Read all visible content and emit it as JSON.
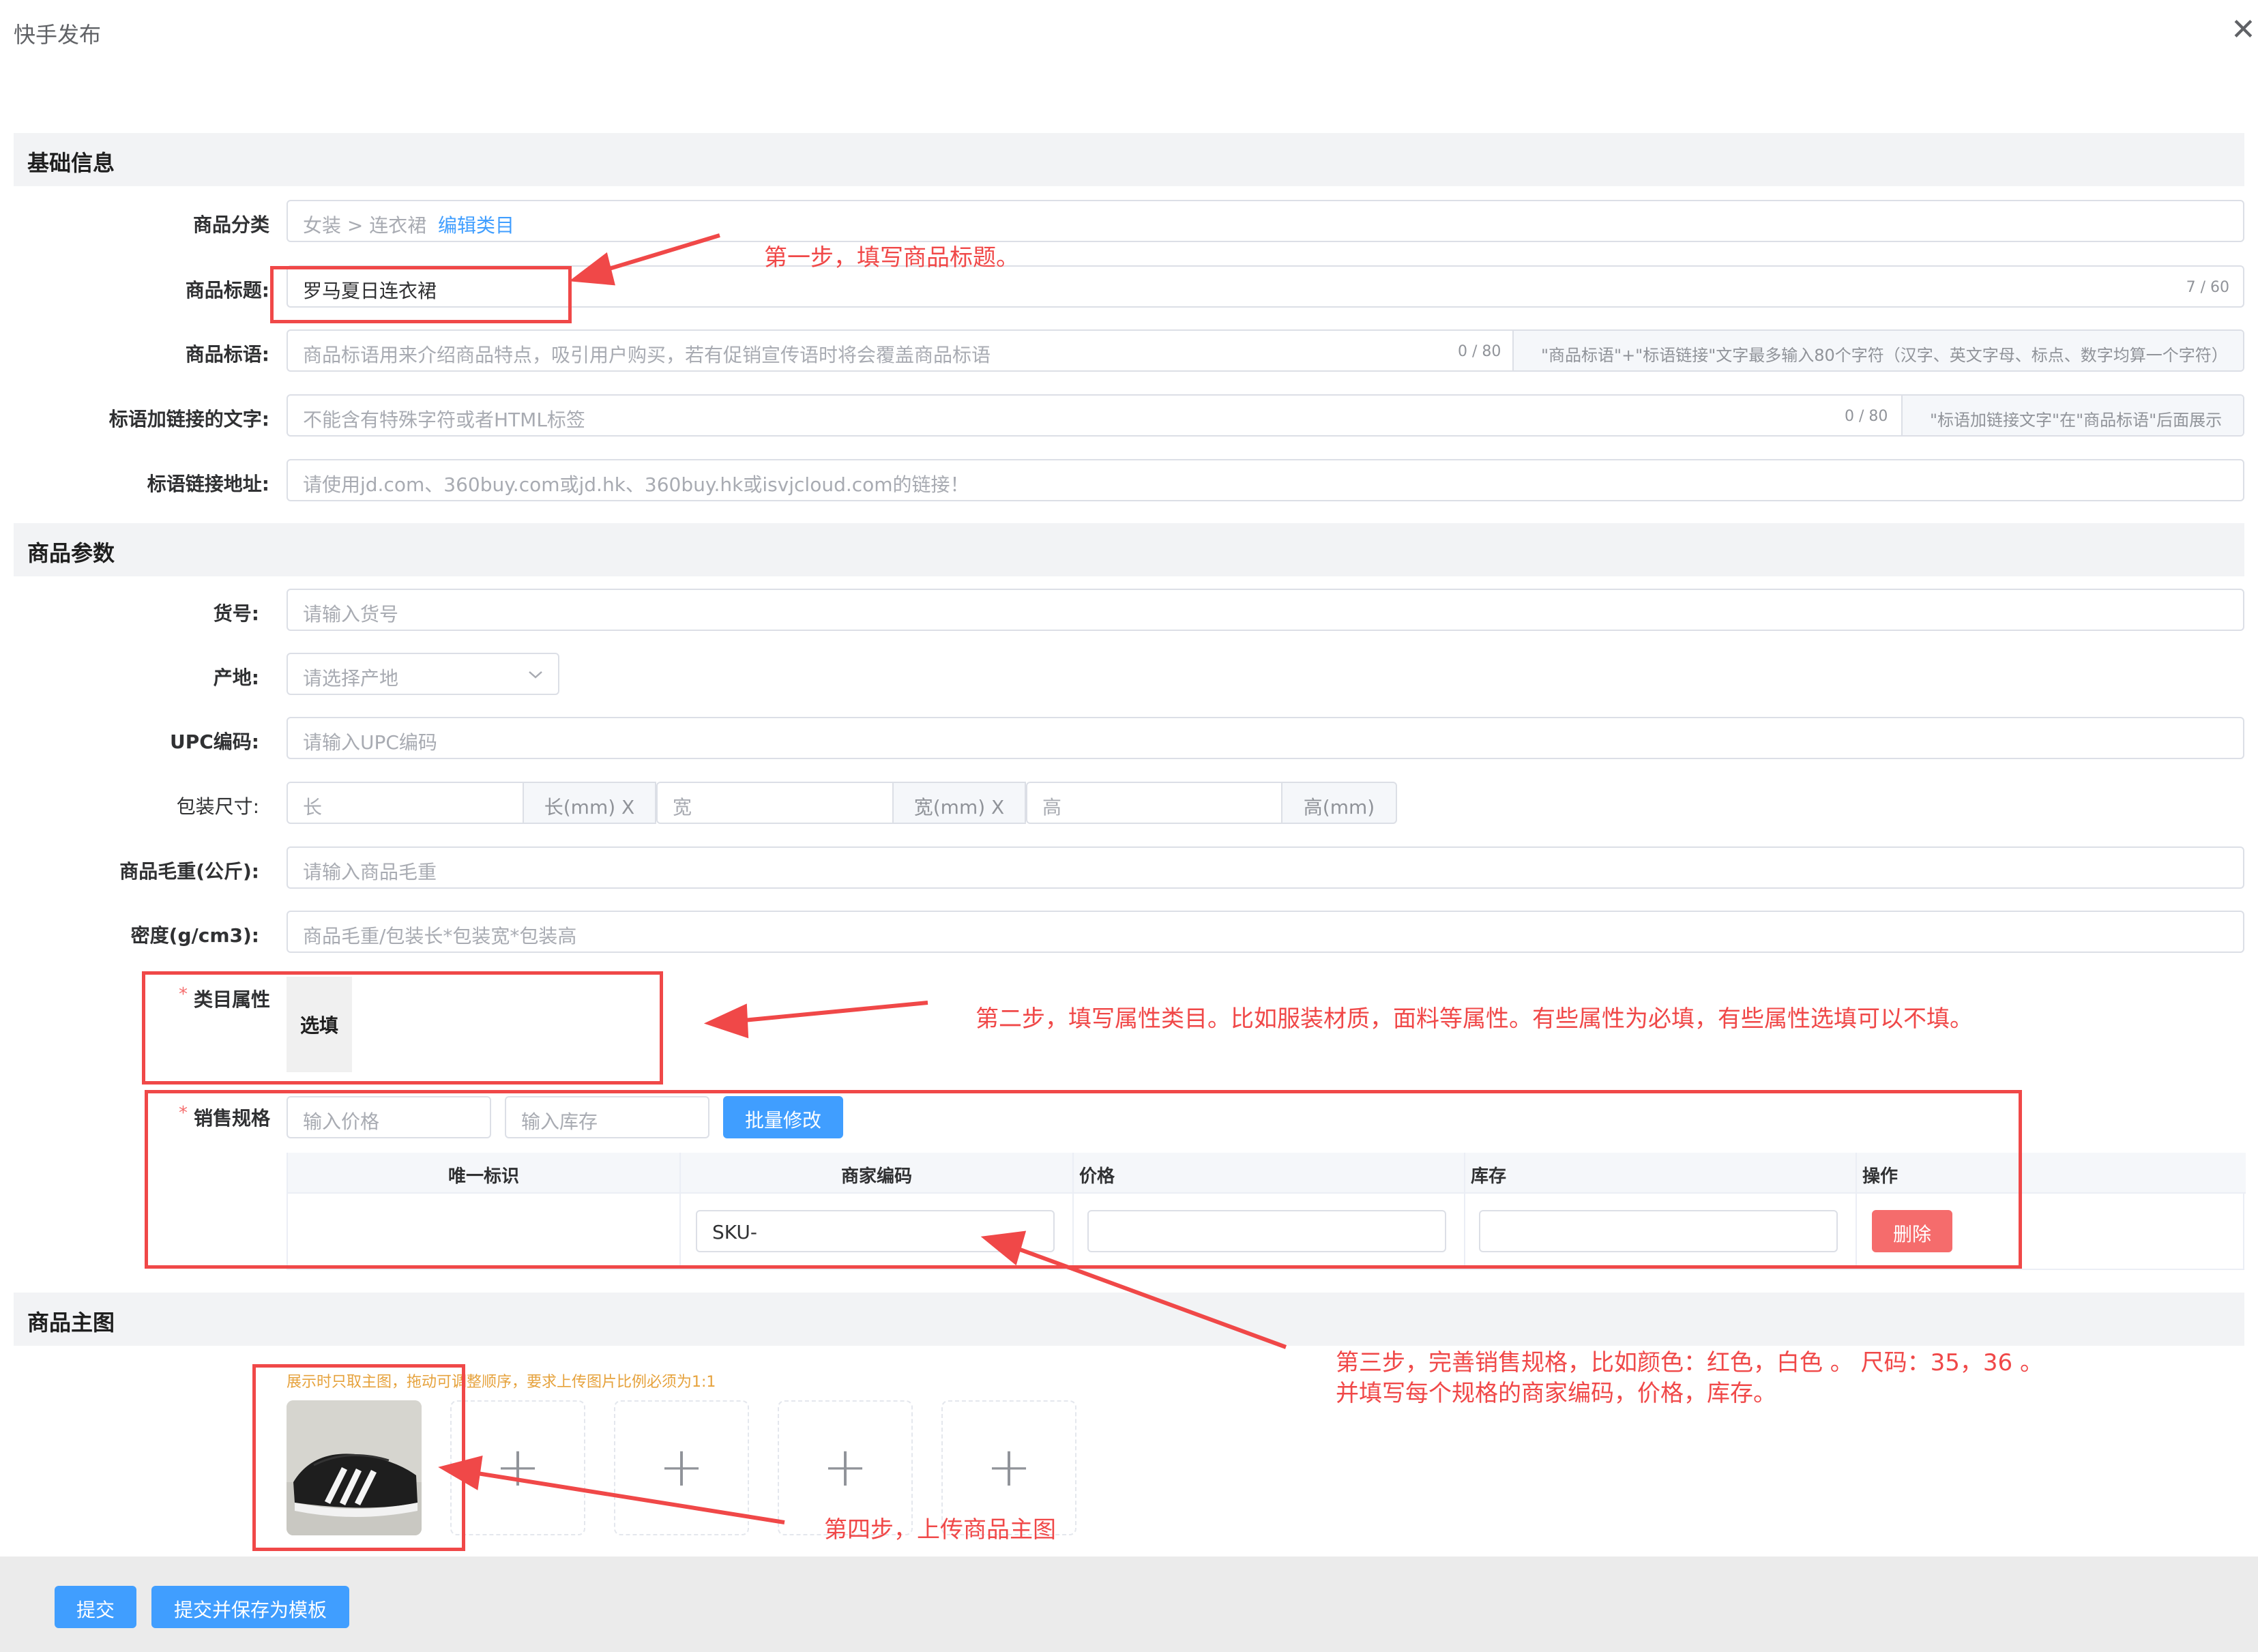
{
  "dialog": {
    "title": "快手发布",
    "close_symbol": "✕"
  },
  "sections": {
    "basic": "基础信息",
    "params": "商品参数",
    "images": "商品主图"
  },
  "basic": {
    "category_label": "商品分类",
    "category_path": "女装 > 连衣裙",
    "edit_category": "编辑类目",
    "title_label": "商品标题:",
    "title_value": "罗马夏日连衣裙",
    "title_count": "7 / 60",
    "slogan_label": "商品标语:",
    "slogan_placeholder": "商品标语用来介绍商品特点，吸引用户购买，若有促销宣传语时将会覆盖商品标语",
    "slogan_count": "0 / 80",
    "slogan_hint": "\"商品标语\"+\"标语链接\"文字最多输入80个字符（汉字、英文字母、标点、数字均算一个字符）",
    "link_text_label": "标语加链接的文字:",
    "link_text_placeholder": "不能含有特殊字符或者HTML标签",
    "link_text_count": "0 / 80",
    "link_text_hint": "\"标语加链接文字\"在\"商品标语\"后面展示",
    "link_url_label": "标语链接地址:",
    "link_url_placeholder": "请使用jd.com、360buy.com或jd.hk、360buy.hk或isvjcloud.com的链接！"
  },
  "params": {
    "sku_label": "货号:",
    "sku_placeholder": "请输入货号",
    "origin_label": "产地:",
    "origin_placeholder": "请选择产地",
    "upc_label": "UPC编码:",
    "upc_placeholder": "请输入UPC编码",
    "pack_label": "包装尺寸:",
    "pack_length_placeholder": "长",
    "pack_length_unit": "长(mm) X",
    "pack_width_placeholder": "宽",
    "pack_width_unit": "宽(mm) X",
    "pack_height_placeholder": "高",
    "pack_height_unit": "高(mm)",
    "weight_label": "商品毛重(公斤):",
    "weight_placeholder": "请输入商品毛重",
    "density_label": "密度(g/cm3):",
    "density_placeholder": "商品毛重/包装长*包装宽*包装高",
    "attr_label": "类目属性",
    "attr_tag": "选填",
    "spec_label": "销售规格",
    "price_placeholder": "输入价格",
    "stock_placeholder": "输入库存",
    "batch_button": "批量修改",
    "required_mark": "*",
    "table": {
      "headers": [
        "唯一标识",
        "商家编码",
        "价格",
        "库存",
        "操作"
      ],
      "row": {
        "merchant_code": "SKU-",
        "delete": "删除"
      }
    }
  },
  "images": {
    "hint": "展示时只取主图，拖动可调整顺序，要求上传图片比例必须为1:1",
    "plus": "+"
  },
  "annotations": {
    "step1": "第一步，填写商品标题。",
    "step2": "第二步，填写属性类目。比如服装材质，面料等属性。有些属性为必填，有些属性选填可以不填。",
    "step3_line1": "第三步，完善销售规格，比如颜色：红色，白色 。 尺码：35，36 。",
    "step3_line2": "并填写每个规格的商家编码，价格，库存。",
    "step4": "第四步，上传商品主图"
  },
  "footer": {
    "submit": "提交",
    "submit_template": "提交并保存为模板"
  },
  "colors": {
    "primary": "#409eff",
    "danger": "#f56c6c",
    "annotation": "#f04848",
    "warning_text": "#e6a23c"
  }
}
